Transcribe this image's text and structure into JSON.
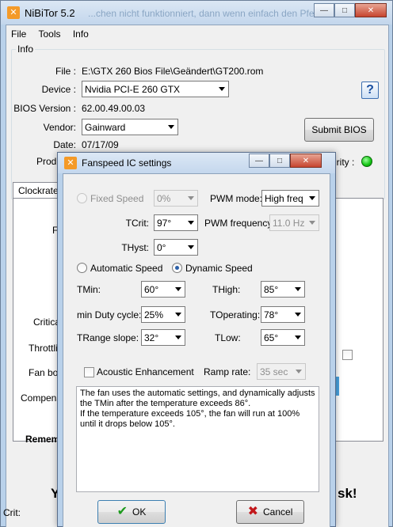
{
  "main": {
    "title": "NiBiTor 5.2",
    "bg_text": "...chen nicht funktionniert, dann wenn einfach den Pfeil...",
    "menu": [
      "File",
      "Tools",
      "Info"
    ],
    "info_group": "Info",
    "file_label": "File :",
    "file_value": "E:\\GTX 260 Bios File\\Geändert\\GT200.rom",
    "device_label": "Device :",
    "device_value": "Nvidia PCI-E 260 GTX",
    "bios_label": "BIOS Version :",
    "bios_value": "62.00.49.00.03",
    "vendor_label": "Vendor:",
    "vendor_value": "Gainward",
    "date_label": "Date:",
    "date_value": "07/17/09",
    "product_label": "Produ",
    "integrity_label": "grity :",
    "submit_bios": "Submit BIOS",
    "help": "?",
    "tab_clockrates": "Clockrates",
    "side_labels": [
      "F",
      "Critica",
      "Throttlin",
      "Fan boo",
      "Compens"
    ],
    "remember_label": "Remem",
    "bottom_left": "Y",
    "bottom_right": "sk!",
    "status_crit": "Crit:"
  },
  "dialog": {
    "title": "Fanspeed IC settings",
    "fixed_speed_label": "Fixed Speed",
    "fixed_speed_value": "0%",
    "pwm_mode_label": "PWM mode:",
    "pwm_mode_value": "High freq",
    "tcrit_label": "TCrit:",
    "tcrit_value": "97°",
    "pwm_freq_label": "PWM frequency:",
    "pwm_freq_value": "11.0 Hz",
    "thyst_label": "THyst:",
    "thyst_value": "0°",
    "automatic_speed": "Automatic Speed",
    "dynamic_speed": "Dynamic Speed",
    "tmin_label": "TMin:",
    "tmin_value": "60°",
    "thigh_label": "THigh:",
    "thigh_value": "85°",
    "min_duty_label": "min Duty cycle:",
    "min_duty_value": "25%",
    "toperating_label": "TOperating:",
    "toperating_value": "78°",
    "trange_label": "TRange slope:",
    "trange_value": "32°",
    "tlow_label": "TLow:",
    "tlow_value": "65°",
    "acoustic_label": "Acoustic Enhancement",
    "ramp_rate_label": "Ramp rate:",
    "ramp_rate_value": "35 sec",
    "description_line1": "The fan uses the automatic settings, and dynamically adjusts",
    "description_line2": "the TMin after the temperature exceeds 86°.",
    "description_line3": "If the temperature exceeds 105°, the fan will run at 100%",
    "description_line4": "until it drops below 105°.",
    "ok": "OK",
    "cancel": "Cancel"
  },
  "colors": {
    "frame": "#b9d1ea",
    "integrity_led": "#12c412",
    "ok_icon": "#1d9a1d",
    "cancel_icon": "#c2181b"
  }
}
